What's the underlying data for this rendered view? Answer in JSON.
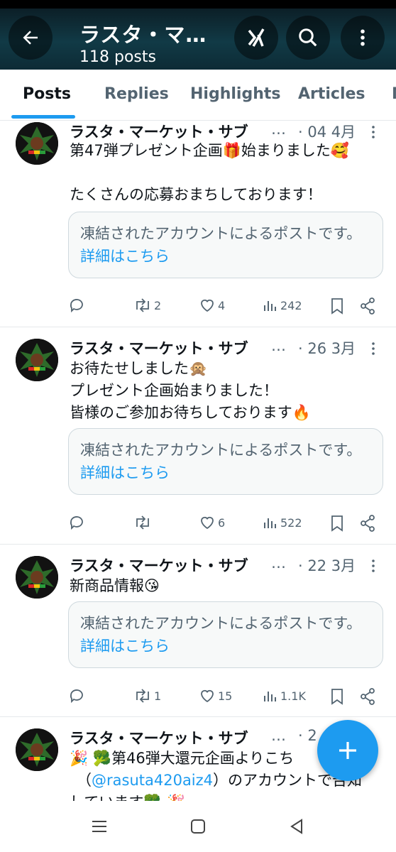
{
  "header": {
    "title": "ラスタ・マ…",
    "post_count": "118 posts"
  },
  "tabs": [
    {
      "label": "Posts",
      "active": true
    },
    {
      "label": "Replies"
    },
    {
      "label": "Highlights"
    },
    {
      "label": "Articles"
    }
  ],
  "posts": [
    {
      "name": "ラスタ・マーケット・サブ",
      "ellipsis": "…",
      "date": "· 04 4月",
      "text": "第47弾プレゼント企画🎁始まりました🥰\n\nたくさんの応募おまちしております！",
      "frozen_text": "凍結されたアカウントによるポストです。",
      "frozen_link": "詳細はこちら",
      "replies": "",
      "reposts": "2",
      "likes": "4",
      "views": "242"
    },
    {
      "name": "ラスタ・マーケット・サブ",
      "ellipsis": "…",
      "date": "· 26 3月",
      "text": "お待たせしました🙊\nプレゼント企画始まりました！\n皆様のご参加お待ちしております🔥",
      "frozen_text": "凍結されたアカウントによるポストです。",
      "frozen_link": "詳細はこちら",
      "replies": "",
      "reposts": "",
      "likes": "6",
      "views": "522"
    },
    {
      "name": "ラスタ・マーケット・サブ",
      "ellipsis": "…",
      "date": "· 22 3月",
      "text": "新商品情報😘",
      "frozen_text": "凍結されたアカウントによるポストです。",
      "frozen_link": "詳細はこちら",
      "replies": "",
      "reposts": "1",
      "likes": "15",
      "views": "1.1K"
    },
    {
      "name": "ラスタ・マーケット・サブ",
      "ellipsis": "…",
      "date": "· 2",
      "text_line1": "🎉 🥦第46弾大還元企画よりこち",
      "text_line2_pre": "（",
      "mention": "@rasuta420aiz4",
      "text_line2_post": "）のアカウントで告知",
      "text_line3": "しています🥦 🎉"
    }
  ],
  "colors": {
    "accent": "#1d9bf0",
    "header_bg": "#113a46",
    "text_secondary": "#536471"
  },
  "icons": [
    "back-arrow-icon",
    "grok-icon",
    "search-icon",
    "more-vertical-icon",
    "reply-icon",
    "repost-icon",
    "like-icon",
    "views-icon",
    "bookmark-icon",
    "share-icon",
    "plus-icon"
  ]
}
